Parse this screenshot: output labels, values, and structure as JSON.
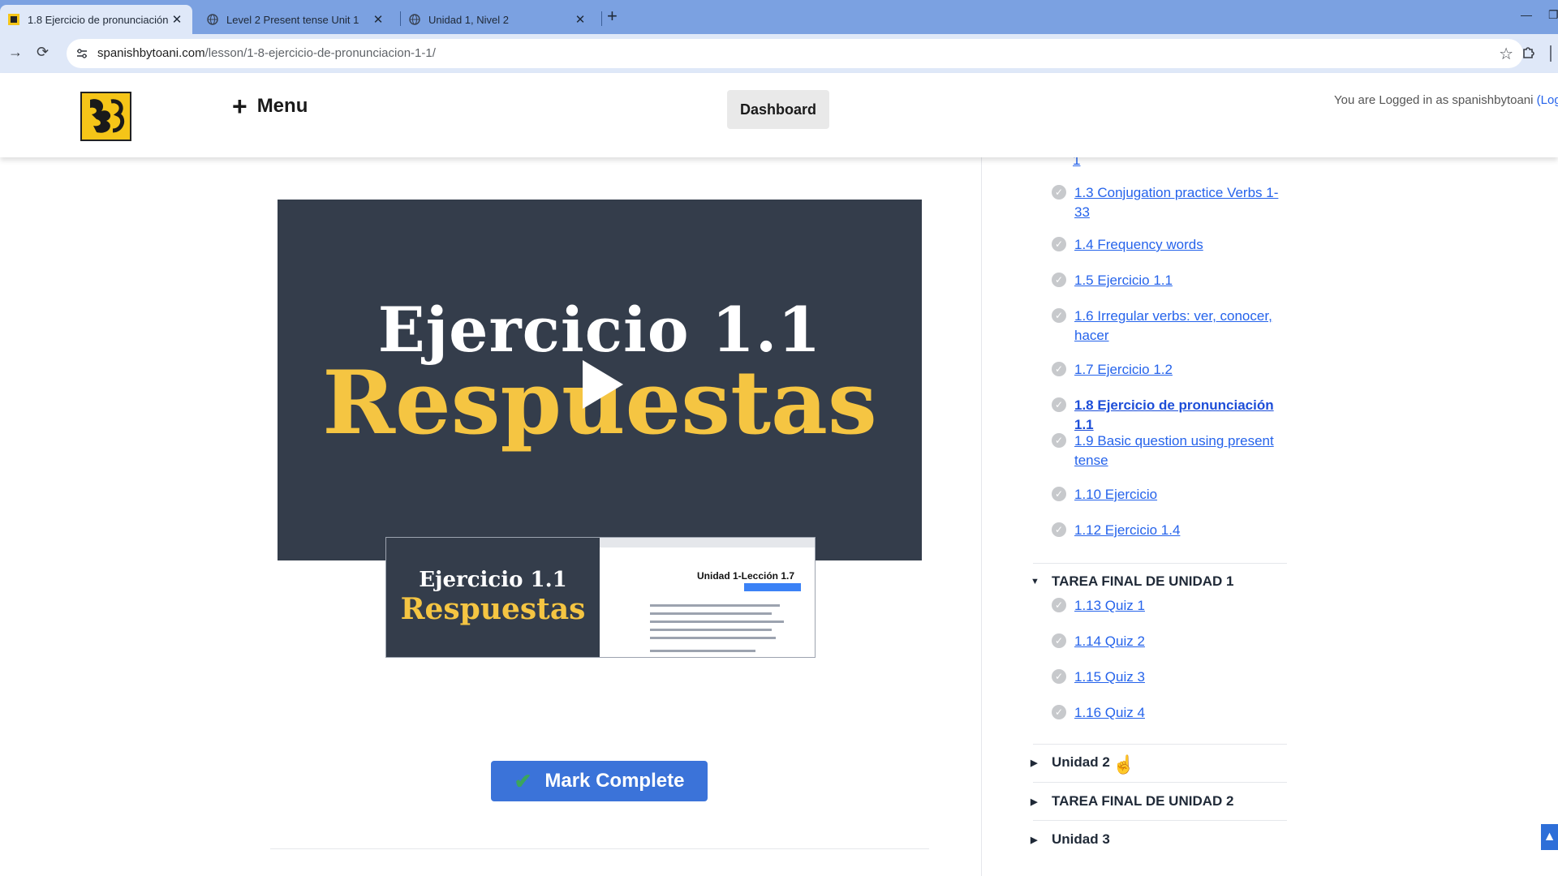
{
  "browser": {
    "tabs": [
      {
        "title": "1.8 Ejercicio de pronunciación",
        "close": "✕"
      },
      {
        "title": "Level 2 Present tense Unit 1",
        "close": "✕"
      },
      {
        "title": "Unidad 1, Nivel 2",
        "close": "✕"
      }
    ],
    "new_tab": "+",
    "url_host": "spanishbytoani.com",
    "url_path": "/lesson/1-8-ejercicio-de-pronunciacion-1-1/"
  },
  "header": {
    "menu_plus": "+",
    "menu_label": "Menu",
    "dashboard_label": "Dashboard",
    "login_text": "You are Logged in as spanishbytoani",
    "logout_open": "(Logo"
  },
  "video": {
    "title_line1": "Ejercicio 1.1",
    "title_line2": "Respuestas"
  },
  "preview": {
    "line1": "Ejercicio 1.1",
    "line2": "Respuestas",
    "doc_heading": "Unidad 1-Lección 1.7"
  },
  "main": {
    "mark_complete_check": "✔",
    "mark_complete_label": "Mark Complete"
  },
  "sidebar": {
    "partial_item": "1",
    "lessons": [
      {
        "label": "1.3 Conjugation practice Verbs 1-",
        "label2": "33"
      },
      {
        "label": "1.4 Frequency words"
      },
      {
        "label": "1.5 Ejercicio 1.1"
      },
      {
        "label": "1.6 Irregular verbs: ver, conocer,",
        "label2": "hacer"
      },
      {
        "label": "1.7 Ejercicio 1.2"
      },
      {
        "label": "1.8 Ejercicio de pronunciación 1.1"
      },
      {
        "label": "1.9 Basic question using present",
        "label2": "tense"
      },
      {
        "label": "1.10 Ejercicio"
      },
      {
        "label": "1.12 Ejercicio 1.4"
      }
    ],
    "section_tarea1": "TAREA FINAL DE UNIDAD 1",
    "tarea1_lessons": [
      {
        "label": "1.13 Quiz 1"
      },
      {
        "label": "1.14 Quiz 2"
      },
      {
        "label": "1.15 Quiz 3"
      },
      {
        "label": "1.16 Quiz 4"
      }
    ],
    "collapsed_sections": [
      {
        "label": "Unidad 2"
      },
      {
        "label": "TAREA FINAL DE UNIDAD 2"
      },
      {
        "label": "Unidad 3"
      }
    ],
    "check_glyph": "✓",
    "caret_open": "▼",
    "caret_closed": "▶"
  },
  "colors": {
    "tab_bar": "#7ba1e1",
    "toolbar": "#dfe8f8",
    "video_bg": "#343d4b",
    "video_accent": "#f5c542",
    "link": "#2563eb",
    "button": "#3b73d9"
  }
}
